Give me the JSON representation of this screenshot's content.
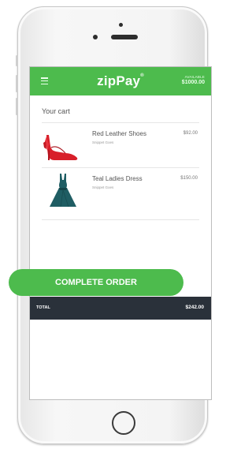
{
  "header": {
    "brand": "zipPay",
    "trademark": "®",
    "available_label": "AVAILABLE",
    "available_amount": "$1000.00"
  },
  "cart": {
    "title": "Your cart",
    "items": [
      {
        "name": "Red Leather Shoes",
        "description": "Snippet Goes",
        "price": "$92.00",
        "icon": "red-shoe-icon"
      },
      {
        "name": "Teal Ladies Dress",
        "description": "Snippet Goes",
        "price": "$150.00",
        "icon": "teal-dress-icon"
      }
    ]
  },
  "total": {
    "label": "TOTAL",
    "amount": "$242.00"
  },
  "actions": {
    "complete_label": "COMPLETE ORDER"
  },
  "colors": {
    "brand_green": "#4dbb4d",
    "total_bar": "#2a313a",
    "shoe_red": "#d81f2a",
    "dress_teal": "#1f5d63"
  }
}
